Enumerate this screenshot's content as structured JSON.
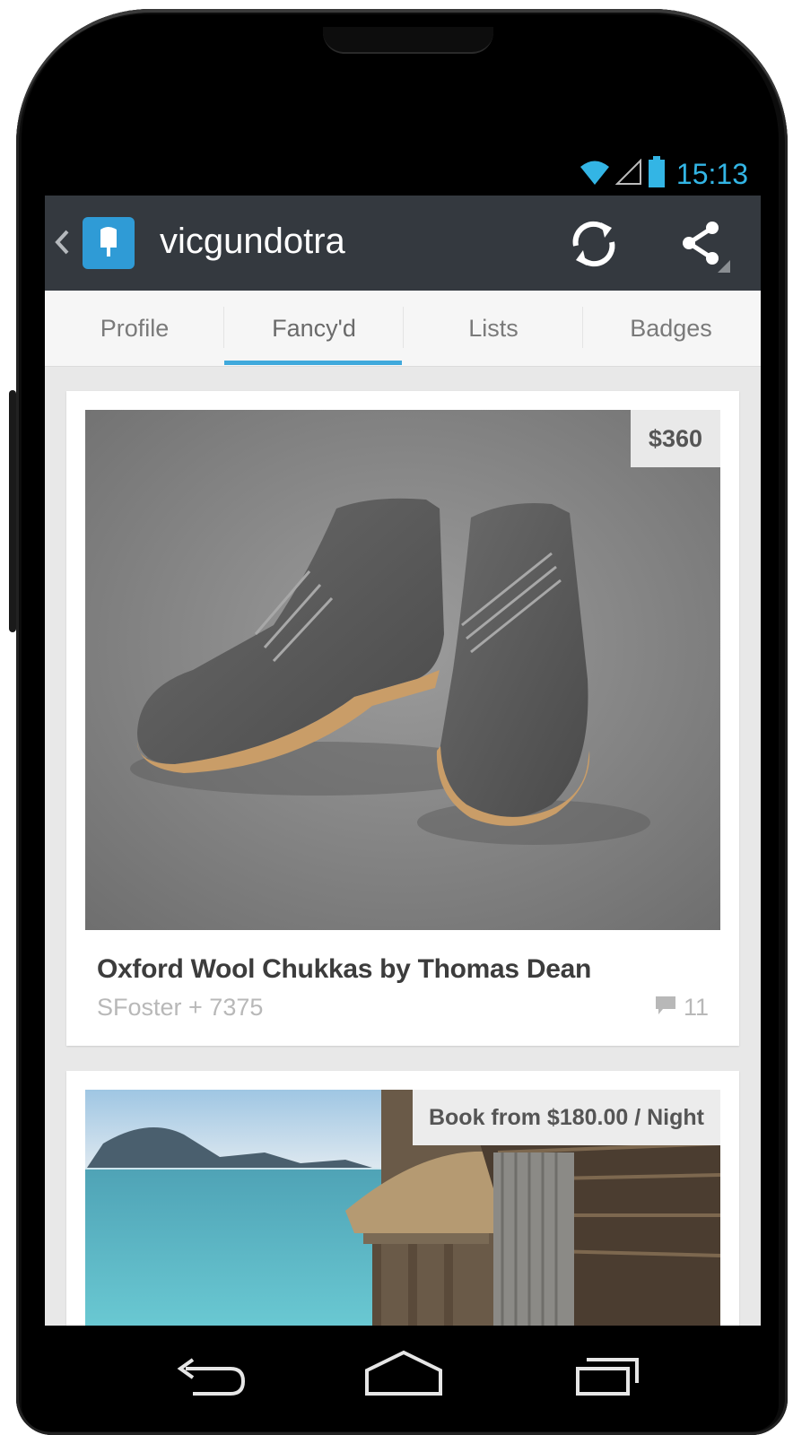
{
  "status_bar": {
    "time": "15:13",
    "icons": [
      "wifi-icon",
      "signal-icon",
      "battery-icon"
    ],
    "accent_color": "#33b5e5"
  },
  "action_bar": {
    "title": "vicgundotra",
    "icons": [
      "back-chevron-icon",
      "app-logo-icon",
      "refresh-icon",
      "share-icon"
    ]
  },
  "tabs": [
    {
      "label": "Profile",
      "active": false
    },
    {
      "label": "Fancy'd",
      "active": true
    },
    {
      "label": "Lists",
      "active": false
    },
    {
      "label": "Badges",
      "active": false
    }
  ],
  "cards": [
    {
      "price": "$360",
      "title": "Oxford Wool Chukkas by Thomas Dean",
      "meta": "SFoster + 7375",
      "comments": "11",
      "image": "grey-wool-chukka-boots-photo"
    },
    {
      "price": "Book from $180.00 / Night",
      "image": "tropical-water-bungalow-photo"
    }
  ],
  "nav_bar": {
    "icons": [
      "back-icon",
      "home-icon",
      "recent-apps-icon"
    ]
  },
  "colors": {
    "action_bar": "#34393f",
    "tab_indicator": "#40a9dc",
    "app_icon": "#2f9bd6"
  }
}
